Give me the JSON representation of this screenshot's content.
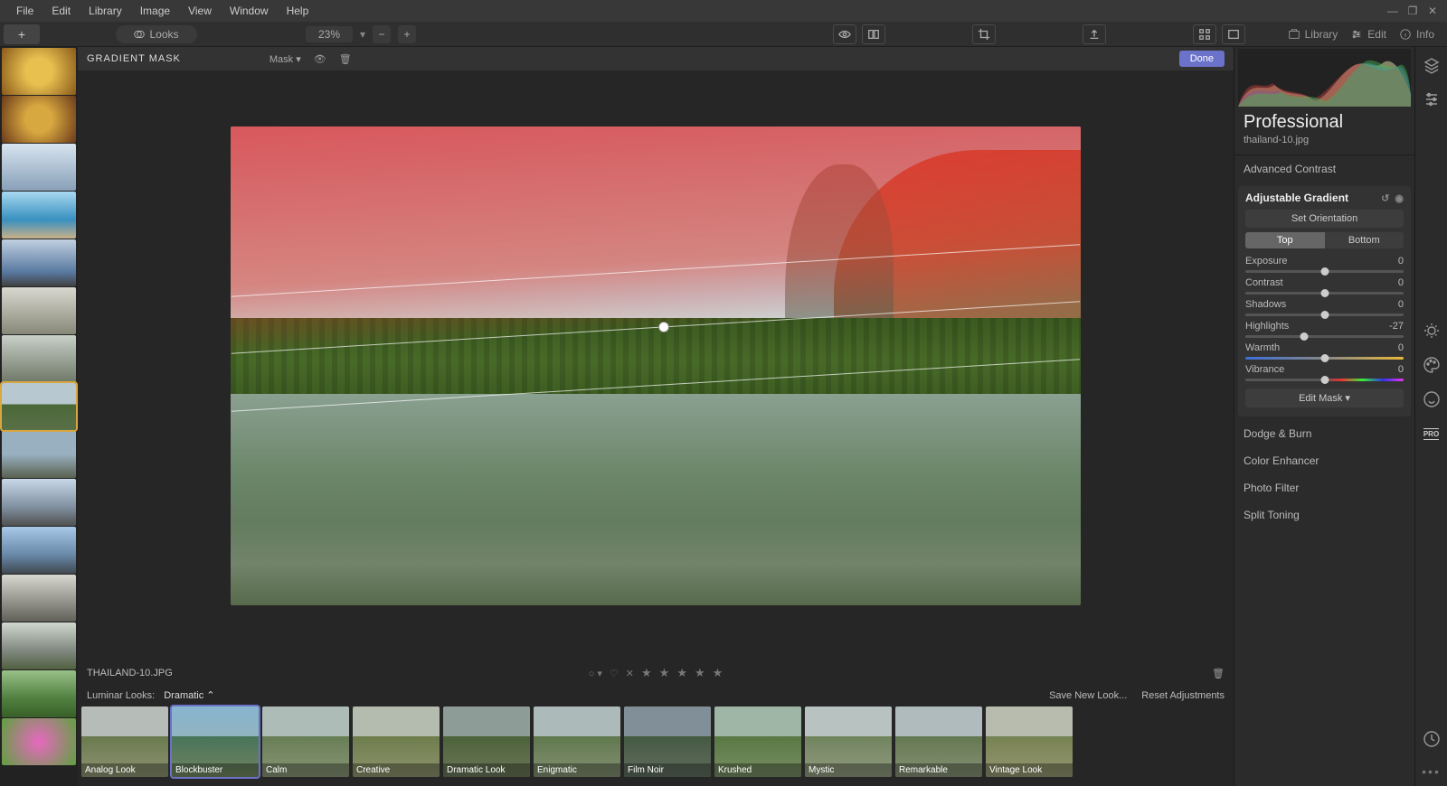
{
  "menu": {
    "items": [
      "File",
      "Edit",
      "Library",
      "Image",
      "View",
      "Window",
      "Help"
    ]
  },
  "toolbar": {
    "looks_label": "Looks",
    "zoom": "23%",
    "modes": {
      "library": "Library",
      "edit": "Edit",
      "info": "Info"
    }
  },
  "mask_bar": {
    "title": "GRADIENT MASK",
    "mask_dropdown": "Mask",
    "done": "Done"
  },
  "thumbnails": [
    {
      "cls": "tg1"
    },
    {
      "cls": "tg2"
    },
    {
      "cls": "tg3"
    },
    {
      "cls": "tg4"
    },
    {
      "cls": "tg5"
    },
    {
      "cls": "tg6"
    },
    {
      "cls": "tg7"
    },
    {
      "cls": "tg8",
      "selected": true
    },
    {
      "cls": "tg9"
    },
    {
      "cls": "tg10"
    },
    {
      "cls": "tg11"
    },
    {
      "cls": "tg12"
    },
    {
      "cls": "tg13"
    },
    {
      "cls": "tg14"
    },
    {
      "cls": "tg15"
    }
  ],
  "bottom": {
    "filename": "THAILAND-10.JPG",
    "looks_label": "Luminar Looks:",
    "looks_category": "Dramatic",
    "save_new": "Save New Look...",
    "reset": "Reset Adjustments"
  },
  "looks": [
    {
      "label": "Analog Look",
      "tint": "lt-analog"
    },
    {
      "label": "Blockbuster",
      "tint": "lt-block",
      "selected": true
    },
    {
      "label": "Calm",
      "tint": "lt-calm"
    },
    {
      "label": "Creative",
      "tint": "lt-creative"
    },
    {
      "label": "Dramatic Look",
      "tint": "lt-drama"
    },
    {
      "label": "Enigmatic",
      "tint": "lt-enig"
    },
    {
      "label": "Film Noir",
      "tint": "lt-noir"
    },
    {
      "label": "Krushed",
      "tint": "lt-krush"
    },
    {
      "label": "Mystic",
      "tint": "lt-mystic"
    },
    {
      "label": "Remarkable",
      "tint": "lt-remark"
    },
    {
      "label": "Vintage Look",
      "tint": "lt-vintage"
    }
  ],
  "panel": {
    "preset": "Professional",
    "filename": "thailand-10.jpg",
    "tools_above": [
      "Advanced Contrast"
    ],
    "active_tool": {
      "name": "Adjustable Gradient",
      "set_orientation": "Set Orientation",
      "tabs": {
        "top": "Top",
        "bottom": "Bottom",
        "active": "top"
      },
      "sliders": [
        {
          "label": "Exposure",
          "value": 0,
          "pos": 50,
          "track": ""
        },
        {
          "label": "Contrast",
          "value": 0,
          "pos": 50,
          "track": ""
        },
        {
          "label": "Shadows",
          "value": 0,
          "pos": 50,
          "track": ""
        },
        {
          "label": "Highlights",
          "value": -27,
          "pos": 37,
          "track": ""
        },
        {
          "label": "Warmth",
          "value": 0,
          "pos": 50,
          "track": "warmth"
        },
        {
          "label": "Vibrance",
          "value": 0,
          "pos": 50,
          "track": "vibrance"
        }
      ],
      "edit_mask": "Edit Mask"
    },
    "tools_below": [
      "Dodge & Burn",
      "Color Enhancer",
      "Photo Filter",
      "Split Toning"
    ]
  },
  "side_icons": [
    "layers",
    "sliders",
    "sun",
    "palette",
    "smile",
    "pro"
  ]
}
